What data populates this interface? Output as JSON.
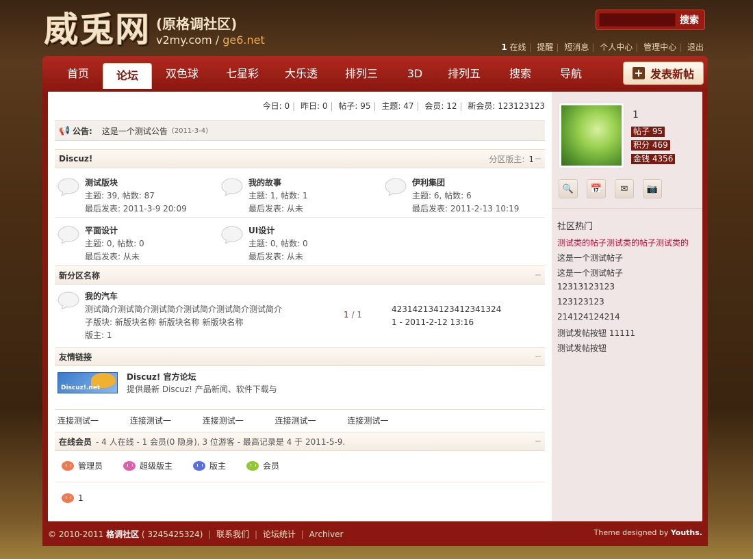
{
  "logo": {
    "main": "威兎网",
    "sub": "(原格调社区)",
    "url_main": "v2my.com / ",
    "url_alt": "ge6.net"
  },
  "search": {
    "button": "搜索"
  },
  "toplinks": {
    "online_count": "1",
    "online_label": "在线",
    "items": [
      "提醒",
      "短消息",
      "个人中心",
      "管理中心",
      "退出"
    ]
  },
  "nav": {
    "items": [
      "首页",
      "论坛",
      "双色球",
      "七星彩",
      "大乐透",
      "排列三",
      "3D",
      "排列五",
      "搜索",
      "导航"
    ],
    "active_index": 1,
    "post_button": "发表新帖"
  },
  "stats": {
    "today": "今日: 0",
    "yesterday": "昨日: 0",
    "posts": "帖子: 95",
    "topics": "主题: 47",
    "members": "会员: 12",
    "newest": "新会员: 123123123"
  },
  "notice": {
    "label": "公告:",
    "text": "这是一个测试公告",
    "date": "(2011-3-4)"
  },
  "sections": {
    "discuz": {
      "title": "Discuz!",
      "moderator_label": "分区版主:",
      "moderator": "1",
      "forums": [
        {
          "name": "测试版块",
          "stats": "主题: 39, 帖数: 87",
          "last": "最后发表: 2011-3-9 20:09"
        },
        {
          "name": "我的故事",
          "stats": "主题: 1, 帖数: 1",
          "last": "最后发表: 从未"
        },
        {
          "name": "伊利集团",
          "stats": "主题: 6, 帖数: 6",
          "last": "最后发表: 2011-2-13 10:19"
        },
        {
          "name": "平面设计",
          "stats": "主题: 0, 帖数: 0",
          "last": "最后发表: 从未"
        },
        {
          "name": "UI设计",
          "stats": "主题: 0, 帖数: 0",
          "last": "最后发表: 从未"
        }
      ]
    },
    "newzone": {
      "title": "新分区名称",
      "forum": {
        "name": "我的汽车",
        "desc": "测试简介测试简介测试简介测试简介测试简介测试简介",
        "sub": "子版块: 新版块名称  新版块名称  新版块名称",
        "mod": "版主: 1",
        "count_a": "1",
        "count_b": " / 1",
        "last_title": "423142134123412341324",
        "last_info": "1 - 2011-2-12 13:16"
      }
    },
    "links": {
      "title": "友情链接",
      "logo_text": "Discuz!.net",
      "name": "Discuz! 官方论坛",
      "desc": "提供最新 Discuz! 产品新闻、软件下载与",
      "text_links": [
        "连接测试一",
        "连接测试一",
        "连接测试一",
        "连接测试一",
        "连接测试一"
      ]
    },
    "online": {
      "title": "在线会员",
      "summary": "- 4 人在线 - 1 会员(0 隐身), 3 位游客 - 最高记录是 4 于 2011-5-9.",
      "legend": [
        {
          "label": "管理员",
          "color": "#f07a50"
        },
        {
          "label": "超级版主",
          "color": "#e060b0"
        },
        {
          "label": "版主",
          "color": "#5a70e0"
        },
        {
          "label": "会员",
          "color": "#90c830"
        }
      ],
      "users": [
        "1"
      ]
    }
  },
  "sidebar": {
    "username": "1",
    "badges": [
      "帖子 95",
      "积分 469",
      "金钱 4356"
    ],
    "icons": [
      "profile-icon",
      "calendar-icon",
      "mail-icon",
      "photo-icon"
    ],
    "hot_title": "社区热门",
    "hot": [
      "测试类的帖子测试类的帖子测试类的",
      "这是一个测试帖子",
      "这是一个测试帖子",
      "12313123123",
      "123123123",
      "214124124214",
      "测试发帖按钮 11111",
      "测试发帖按钮"
    ]
  },
  "footer": {
    "copyright": "© 2010-2011",
    "site": "格调社区",
    "qq": "( 3245425324)",
    "links": [
      "联系我们",
      "论坛统计",
      "Archiver"
    ],
    "theme": "Theme designed by",
    "author": "Youths."
  },
  "colors": {
    "brand": "#8a1810",
    "accent": "#c0103a"
  }
}
